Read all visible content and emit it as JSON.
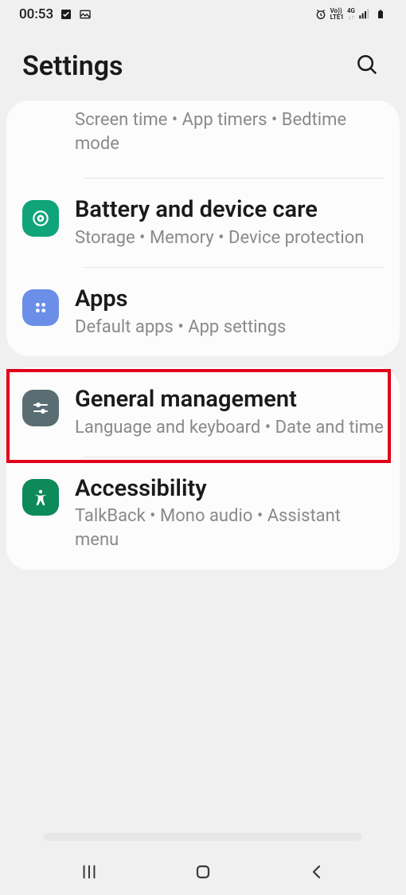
{
  "status": {
    "time": "00:53",
    "net_label_top": "Vo))",
    "net_label_bottom": "LTE1",
    "net_gen": "4G"
  },
  "header": {
    "title": "Settings"
  },
  "groups": [
    {
      "items": [
        {
          "sub": "Screen time  •  App timers  •  Bedtime mode"
        },
        {
          "title": "Battery and device care",
          "sub": "Storage  •  Memory  •  Device protection"
        },
        {
          "title": "Apps",
          "sub": "Default apps  •  App settings"
        }
      ]
    },
    {
      "items": [
        {
          "title": "General management",
          "sub": "Language and keyboard  •  Date and time"
        },
        {
          "title": "Accessibility",
          "sub": "TalkBack  •  Mono audio  •  Assistant menu"
        }
      ]
    }
  ]
}
